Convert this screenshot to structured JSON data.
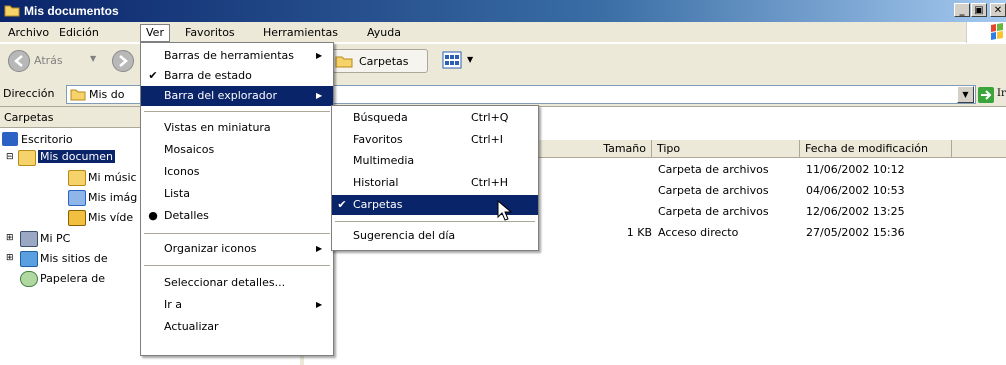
{
  "window": {
    "title": "Mis documentos"
  },
  "menubar": {
    "items": [
      "Archivo",
      "Edición",
      "Ver",
      "Favoritos",
      "Herramientas",
      "Ayuda"
    ]
  },
  "toolbar": {
    "back_label": "Atrás",
    "folders_label": "Carpetas"
  },
  "address": {
    "label": "Dirección",
    "value": "Mis do",
    "go_label": "Ir"
  },
  "tree": {
    "header": "Carpetas",
    "items": [
      "Escritorio",
      "Mis documen",
      "Mi músic",
      "Mis imág",
      "Mis víde",
      "Mi PC",
      "Mis sitios de",
      "Papelera de"
    ]
  },
  "list": {
    "columns": [
      "Tamaño",
      "Tipo",
      "Fecha de modificación"
    ],
    "rows": [
      {
        "size": "",
        "type": "Carpeta de archivos",
        "date": "11/06/2002 10:12"
      },
      {
        "size": "",
        "type": "Carpeta de archivos",
        "date": "04/06/2002 10:53"
      },
      {
        "size": "",
        "type": "Carpeta de archivos",
        "date": "12/06/2002 13:25"
      },
      {
        "size": "1 KB",
        "type": "Acceso directo",
        "date": "27/05/2002 15:36"
      }
    ]
  },
  "ver_menu": {
    "items": [
      {
        "label": "Barras de herramientas",
        "check": "",
        "submenu": true
      },
      {
        "label": "Barra de estado",
        "check": "✔",
        "submenu": false
      },
      {
        "label": "Barra del explorador",
        "check": "",
        "submenu": true,
        "highlighted": true
      },
      {
        "label": "Vistas en miniatura",
        "check": "",
        "submenu": false
      },
      {
        "label": "Mosaicos",
        "check": "",
        "submenu": false
      },
      {
        "label": "Iconos",
        "check": "",
        "submenu": false
      },
      {
        "label": "Lista",
        "check": "",
        "submenu": false
      },
      {
        "label": "Detalles",
        "check": "●",
        "submenu": false
      },
      {
        "label": "Organizar iconos",
        "check": "",
        "submenu": true
      },
      {
        "label": "Seleccionar detalles...",
        "check": "",
        "submenu": false
      },
      {
        "label": "Ir a",
        "check": "",
        "submenu": true
      },
      {
        "label": "Actualizar",
        "check": "",
        "submenu": false
      }
    ]
  },
  "explorer_submenu": {
    "items": [
      {
        "label": "Búsqueda",
        "shortcut": "Ctrl+Q",
        "check": ""
      },
      {
        "label": "Favoritos",
        "shortcut": "Ctrl+I",
        "check": ""
      },
      {
        "label": "Multimedia",
        "shortcut": "",
        "check": ""
      },
      {
        "label": "Historial",
        "shortcut": "Ctrl+H",
        "check": ""
      },
      {
        "label": "Carpetas",
        "shortcut": "",
        "check": "✔",
        "highlighted": true
      },
      {
        "label": "Sugerencia del día",
        "shortcut": "",
        "check": ""
      }
    ]
  },
  "colors": {
    "titlebar": "#0a246a",
    "highlight": "#0a246a",
    "face": "#ece9d8"
  }
}
